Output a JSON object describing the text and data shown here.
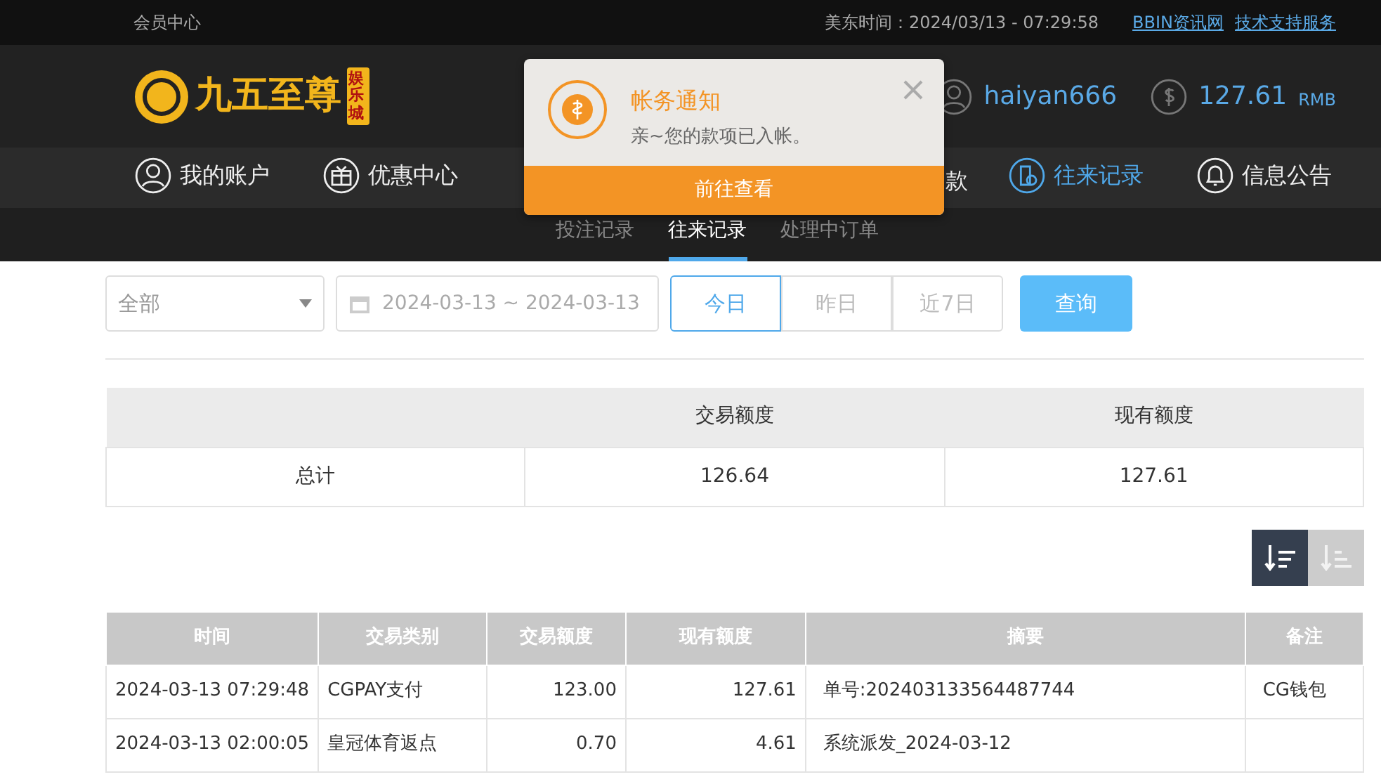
{
  "top_bar": {
    "title": "会员中心",
    "time_label": "美东时间：",
    "time": "2024/03/13 - 07:29:58",
    "links": [
      "BBIN资讯网",
      "技术支持服务"
    ]
  },
  "header": {
    "logo_text": "九五至尊",
    "logo_badge": "娱乐城",
    "username": "haiyan666",
    "balance": "127.61",
    "currency": "RMB"
  },
  "nav": [
    {
      "label": "我的账户",
      "selected": false
    },
    {
      "label": "优惠中心",
      "selected": false
    },
    {
      "label": "款",
      "selected": false
    },
    {
      "label": "往来记录",
      "selected": true
    },
    {
      "label": "信息公告",
      "selected": false
    }
  ],
  "notification": {
    "title": "帐务通知",
    "message": "亲~您的款项已入帐。",
    "button": "前往查看"
  },
  "sub_tabs": [
    {
      "label": "投注记录",
      "selected": false
    },
    {
      "label": "往来记录",
      "selected": true
    },
    {
      "label": "处理中订单",
      "selected": false
    }
  ],
  "filters": {
    "type_select": "全部",
    "date_range": "2024-03-13 ~ 2024-03-13",
    "quick_ranges": [
      {
        "label": "今日",
        "selected": true
      },
      {
        "label": "昨日",
        "selected": false
      },
      {
        "label": "近7日",
        "selected": false
      }
    ],
    "query_button": "查询"
  },
  "summary": {
    "columns": [
      "",
      "交易额度",
      "现有额度"
    ],
    "rows": [
      [
        "总计",
        "126.64",
        "127.61"
      ]
    ]
  },
  "sort_buttons": [
    {
      "kind": "desc",
      "selected": true
    },
    {
      "kind": "asc",
      "selected": false
    }
  ],
  "table": {
    "columns": [
      "时间",
      "交易类别",
      "交易额度",
      "现有额度",
      "摘要",
      "备注"
    ],
    "rows": [
      [
        "2024-03-13 07:29:48",
        "CGPAY支付",
        "123.00",
        "127.61",
        "单号:202403133564487744",
        "CG钱包"
      ],
      [
        "2024-03-13 02:00:05",
        "皇冠体育返点",
        "0.70",
        "4.61",
        "系统派发_2024-03-12",
        ""
      ]
    ]
  }
}
